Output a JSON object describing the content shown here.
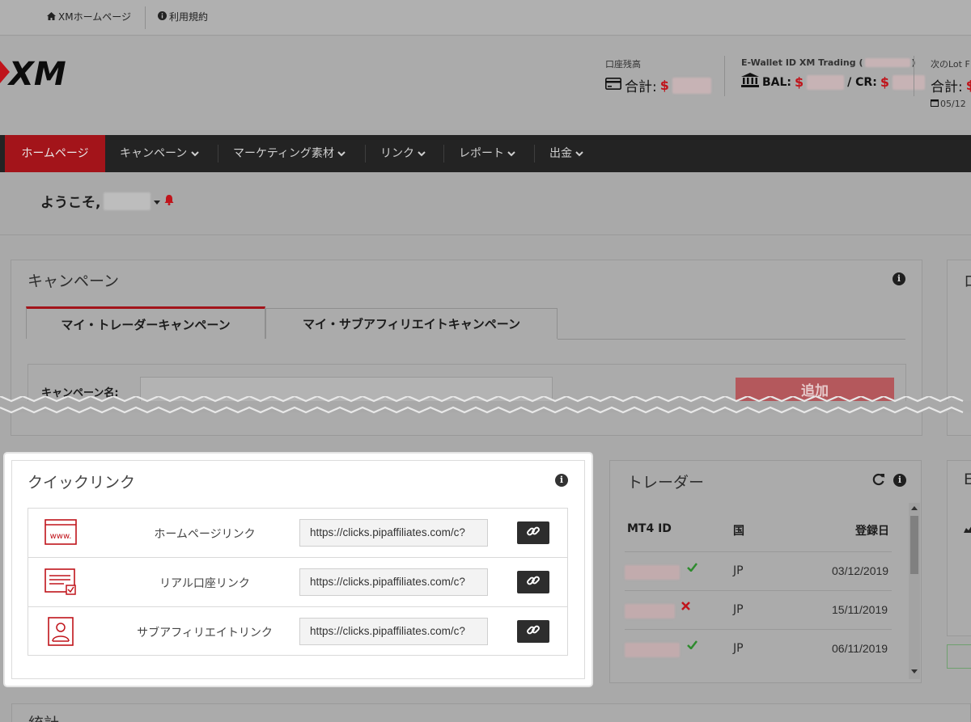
{
  "topbar": {
    "home_link": "XMホームページ",
    "terms_link": "利用規約"
  },
  "logo": {
    "text": "XM"
  },
  "header": {
    "balance_label": "口座残高",
    "balance_total": "合計:",
    "ewallet_label": "E-Wallet ID XM Trading (",
    "ewallet_label_end": ")",
    "bal_label": "BAL:",
    "cr_label": "/ CR:",
    "lot_label": "次のLot F",
    "lot_total": "合計:",
    "lot_date": "05/12",
    "currency": "$"
  },
  "nav": {
    "items": [
      "ホームページ",
      "キャンペーン",
      "マーケティング素材",
      "リンク",
      "レポート",
      "出金"
    ]
  },
  "welcome": {
    "text": "ようこそ,"
  },
  "campaign": {
    "title": "キャンペーン",
    "tabs": [
      "マイ・トレーダーキャンペーン",
      "マイ・サブアフィリエイトキャンペーン"
    ],
    "name_label": "キャンペーン名:",
    "add_button": "追加"
  },
  "right_panel": {
    "title_partial": "ロ",
    "second_partial": "E"
  },
  "quick_links": {
    "title": "クイックリンク",
    "rows": [
      {
        "label": "ホームページリンク",
        "url": "https://clicks.pipaffiliates.com/c?",
        "icon": "www-icon"
      },
      {
        "label": "リアル口座リンク",
        "url": "https://clicks.pipaffiliates.com/c?",
        "icon": "form-icon"
      },
      {
        "label": "サブアフィリエイトリンク",
        "url": "https://clicks.pipaffiliates.com/c?",
        "icon": "user-card-icon"
      }
    ]
  },
  "traders": {
    "title": "トレーダー",
    "columns": [
      "MT4 ID",
      "国",
      "登録日"
    ],
    "rows": [
      {
        "country": "JP",
        "date": "03/12/2019",
        "status": "check"
      },
      {
        "country": "JP",
        "date": "15/11/2019",
        "status": "cross"
      },
      {
        "country": "JP",
        "date": "06/11/2019",
        "status": "check"
      }
    ]
  },
  "stats": {
    "title": "統計"
  },
  "colors": {
    "accent": "#a3141a",
    "nav_bg": "#232323",
    "check": "#2e8b2e",
    "cross": "#c0141b"
  }
}
